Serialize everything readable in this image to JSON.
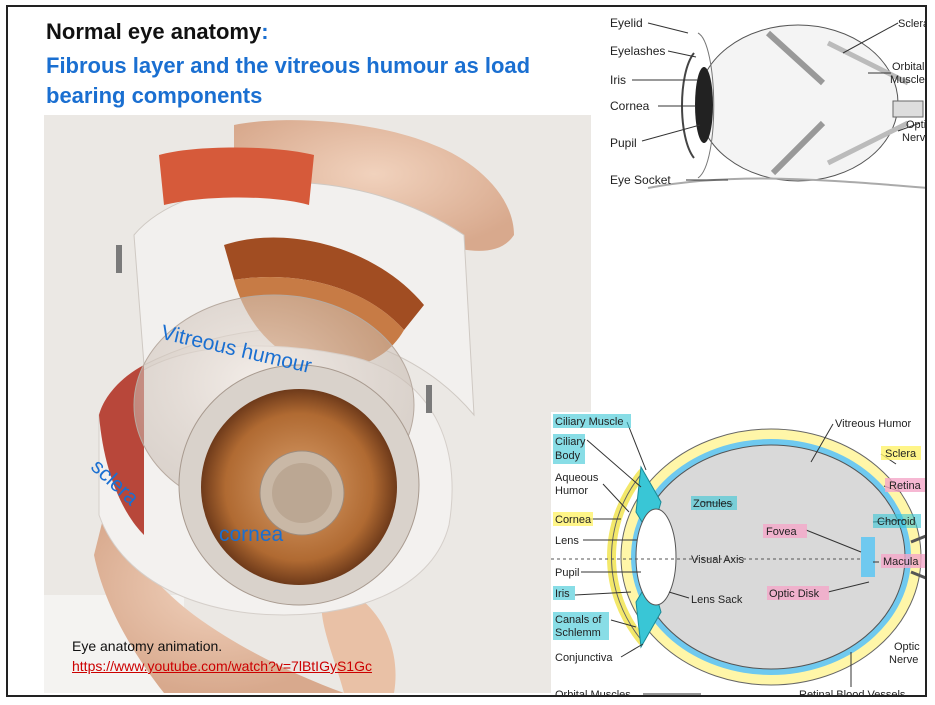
{
  "slide": {
    "title_line1": "Normal eye anatomy",
    "title_colon": ":",
    "title_line2": "Fibrous layer and the vitreous humour as load bearing components",
    "photo_labels": {
      "vitreous": "Vitreous humour",
      "sclera": "sclera",
      "cornea": "cornea"
    },
    "caption": "Eye anatomy animation.",
    "link": "https://www.youtube.com/watch?v=7lBtIGyS1Gc"
  },
  "diagram_top": {
    "labels": {
      "eyelid": "Eyelid",
      "eyelashes": "Eyelashes",
      "iris": "Iris",
      "cornea": "Cornea",
      "pupil": "Pupil",
      "eye_socket": "Eye Socket",
      "sclera": "Sclera",
      "orbital": "Orbital",
      "muscles": "Muscles",
      "optic": "Optic",
      "nerve": "Nerve"
    }
  },
  "diagram_bottom": {
    "labels": {
      "ciliary_muscle": "Ciliary Muscle",
      "ciliary": "Ciliary",
      "body": "Body",
      "aqueous": "Aqueous",
      "humor": "Humor",
      "cornea": "Cornea",
      "lens": "Lens",
      "pupil": "Pupil",
      "iris": "Iris",
      "canals_of": "Canals of",
      "schlemm": "Schlemm",
      "conjunctiva": "Conjunctiva",
      "orbital_muscles": "Orbital Muscles",
      "vitreous_humor": "Vitreous Humor",
      "sclera": "Sclera",
      "retina": "Retina",
      "choroid": "Choroid",
      "macula": "Macula",
      "zonules": "Zonules",
      "fovea": "Fovea",
      "visual_axis": "Visual Axis",
      "lens_sack": "Lens Sack",
      "optic_disk": "Optic Disk",
      "optic": "Optic",
      "nerve": "Nerve",
      "retinal_vessels": "Retinal Blood Vessels"
    }
  }
}
